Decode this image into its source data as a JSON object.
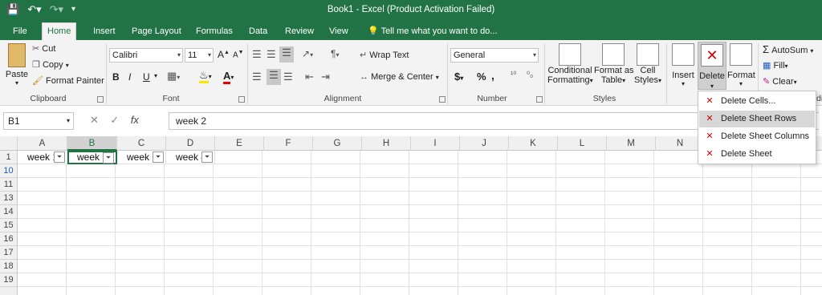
{
  "title": "Book1 - Excel (Product Activation Failed)",
  "tabs": [
    "File",
    "Home",
    "Insert",
    "Page Layout",
    "Formulas",
    "Data",
    "Review",
    "View"
  ],
  "tell_me": "Tell me what you want to do...",
  "clipboard": {
    "paste": "Paste",
    "cut": "Cut",
    "copy": "Copy",
    "format_painter": "Format Painter",
    "label": "Clipboard"
  },
  "font": {
    "name": "Calibri",
    "size": "11",
    "bold": "B",
    "italic": "I",
    "underline": "U",
    "grow": "A",
    "shrink": "A",
    "color_a": "A",
    "label": "Font"
  },
  "alignment": {
    "wrap": "Wrap Text",
    "merge": "Merge & Center",
    "label": "Alignment"
  },
  "number": {
    "format": "General",
    "currency": "$",
    "percent": "%",
    "comma": ",",
    "inc": "¹⁰",
    "dec": "⁰₀",
    "label": "Number"
  },
  "styles": {
    "cond1": "Conditional",
    "cond2": "Formatting",
    "table1": "Format as",
    "table2": "Table",
    "cell1": "Cell",
    "cell2": "Styles",
    "label": "Styles"
  },
  "cells": {
    "insert": "Insert",
    "delete": "Delete",
    "format": "Format"
  },
  "editing": {
    "autosum": "AutoSum",
    "fill": "Fill",
    "clear": "Clear",
    "label": "Editi"
  },
  "name_box": "B1",
  "formula": "week 2",
  "columns": [
    "A",
    "B",
    "C",
    "D",
    "E",
    "F",
    "G",
    "H",
    "I",
    "J",
    "K",
    "L",
    "M",
    "N"
  ],
  "rows": [
    "1",
    "10",
    "11",
    "13",
    "14",
    "15",
    "16",
    "17",
    "18",
    "19"
  ],
  "row1": [
    "week 1",
    "week 2",
    "week 3",
    "week 4"
  ],
  "delete_menu": [
    "Delete Cells...",
    "Delete Sheet Rows",
    "Delete Sheet Columns",
    "Delete Sheet"
  ],
  "colors": {
    "accent": "#217346",
    "menu_icon": "#c00000"
  }
}
